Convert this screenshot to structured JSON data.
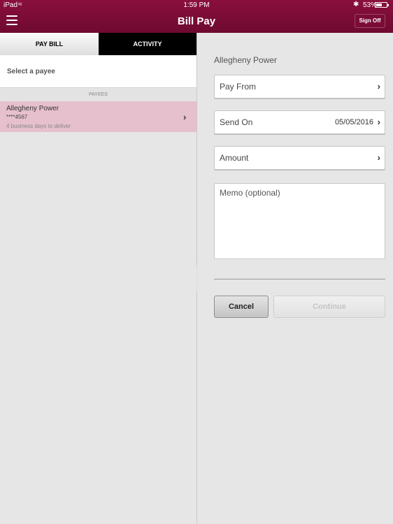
{
  "status_bar": {
    "carrier": "iPad",
    "wifi_icon": "wifi-icon",
    "time": "1:59 PM",
    "bluetooth_icon": "bluetooth-icon",
    "battery_percent": "53%",
    "battery_level": 0.53
  },
  "nav": {
    "menu_icon": "hamburger-menu-icon",
    "title": "Bill Pay",
    "sign_off_label": "Sign Off"
  },
  "colors": {
    "brand": "#7a0c35",
    "selected_row": "#e6c0cc",
    "background": "#e6e6e6"
  },
  "left": {
    "tabs": [
      {
        "label": "PAY BILL",
        "active": true
      },
      {
        "label": "ACTIVITY",
        "active": false
      }
    ],
    "select_prompt": "Select a payee",
    "section_header": "PAYEES",
    "payees": [
      {
        "name": "Allegheny Power",
        "account": "****4567",
        "delivery": "4 business days to deliver",
        "selected": true
      }
    ]
  },
  "right": {
    "payee_name": "Allegheny Power",
    "fields": {
      "pay_from": {
        "label": "Pay From",
        "value": ""
      },
      "send_on": {
        "label": "Send On",
        "value": "05/05/2016"
      },
      "amount": {
        "label": "Amount",
        "value": ""
      }
    },
    "memo_placeholder": "Memo (optional)",
    "cancel_label": "Cancel",
    "continue_label": "Continue"
  }
}
